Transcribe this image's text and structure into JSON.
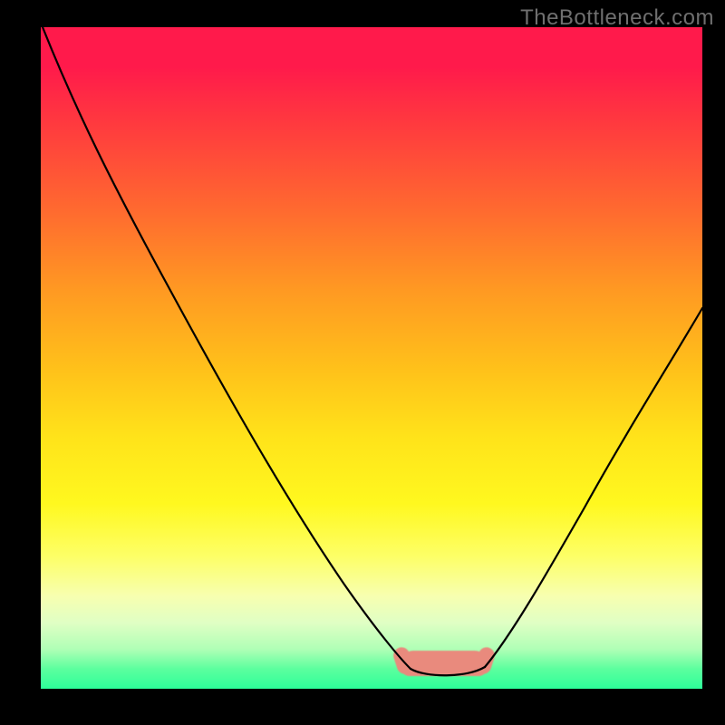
{
  "watermark": "TheBottleneck.com",
  "chart_data": {
    "type": "line",
    "title": "",
    "xlabel": "",
    "ylabel": "",
    "xlim": [
      0,
      100
    ],
    "ylim": [
      0,
      100
    ],
    "background_gradient_stops": [
      {
        "pos": 0.0,
        "color": "#ff1a4b"
      },
      {
        "pos": 0.06,
        "color": "#ff1a4b"
      },
      {
        "pos": 0.15,
        "color": "#ff3b3e"
      },
      {
        "pos": 0.28,
        "color": "#ff6b2f"
      },
      {
        "pos": 0.4,
        "color": "#ff9a22"
      },
      {
        "pos": 0.52,
        "color": "#ffc21a"
      },
      {
        "pos": 0.62,
        "color": "#ffe31a"
      },
      {
        "pos": 0.72,
        "color": "#fff81f"
      },
      {
        "pos": 0.8,
        "color": "#fdff67"
      },
      {
        "pos": 0.86,
        "color": "#f7ffb0"
      },
      {
        "pos": 0.9,
        "color": "#e0ffc4"
      },
      {
        "pos": 0.94,
        "color": "#b0ffb6"
      },
      {
        "pos": 0.97,
        "color": "#5cff9e"
      },
      {
        "pos": 1.0,
        "color": "#2dff9a"
      }
    ],
    "series": [
      {
        "name": "bottleneck-curve",
        "color": "#000000",
        "x": [
          0,
          5,
          10,
          15,
          20,
          25,
          30,
          35,
          40,
          45,
          50,
          55,
          56,
          58,
          60,
          62,
          64,
          66,
          68,
          70,
          75,
          80,
          85,
          90,
          95,
          100
        ],
        "y": [
          100,
          92,
          83,
          74,
          65,
          56,
          47,
          38,
          29,
          20,
          12,
          5,
          3,
          2,
          2,
          2,
          2,
          3,
          6,
          10,
          20,
          31,
          41,
          49,
          55,
          58
        ]
      }
    ],
    "highlight_region": {
      "name": "valley-marker",
      "color": "#e98a7d",
      "x_start": 55,
      "x_end": 68,
      "y_start": 2,
      "y_end": 5
    }
  }
}
